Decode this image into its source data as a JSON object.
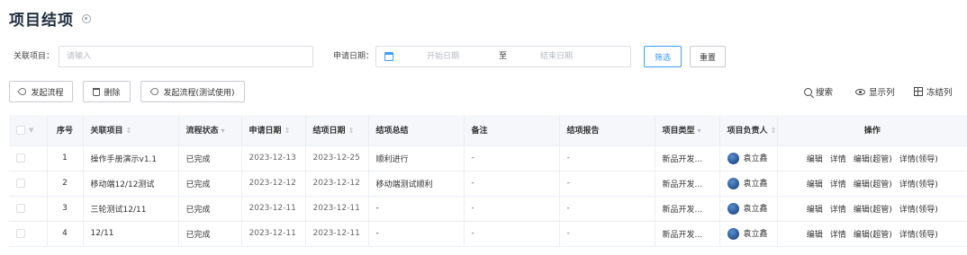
{
  "page": {
    "title": "项目结项",
    "settings_icon": "gear-icon"
  },
  "filters": {
    "project_label": "关联项目：",
    "project_placeholder": "请输入",
    "date_label": "申请日期：",
    "date_start_placeholder": "开始日期",
    "date_sep": "至",
    "date_end_placeholder": "结束日期",
    "filter_button": "筛选",
    "reset_button": "重置"
  },
  "toolbar": {
    "start_flow": "发起流程",
    "delete": "删除",
    "start_flow_test": "发起流程(测试使用)",
    "search": "搜索",
    "show_columns": "显示列",
    "freeze_columns": "冻结列"
  },
  "colors": {
    "accent": "#409eff",
    "header_bg": "#f5f7fa",
    "border": "#ebeef5"
  },
  "table": {
    "headers": {
      "index": "序号",
      "project": "关联项目",
      "flow_status": "流程状态",
      "apply_date": "申请日期",
      "close_date": "结项日期",
      "summary": "结项总结",
      "remark": "备注",
      "report": "结项报告",
      "type": "项目类型",
      "owner": "项目负责人",
      "actions": "操作"
    },
    "row_actions": {
      "edit": "编辑",
      "detail": "详情",
      "edit_super": "编辑(超管)",
      "detail_leader": "详情(领导)"
    },
    "rows": [
      {
        "index": "1",
        "project": "操作手册演示v1.1",
        "status": "已完成",
        "apply_date": "2023-12-13",
        "close_date": "2023-12-25",
        "summary": "顺利进行",
        "remark": "-",
        "report": "-",
        "type": "新品开发...",
        "owner": "袁立鑫"
      },
      {
        "index": "2",
        "project": "移动端12/12测试",
        "status": "已完成",
        "apply_date": "2023-12-12",
        "close_date": "2023-12-12",
        "summary": "移动端测试顺利",
        "remark": "-",
        "report": "-",
        "type": "新品开发...",
        "owner": "袁立鑫"
      },
      {
        "index": "3",
        "project": "三轮测试12/11",
        "status": "已完成",
        "apply_date": "2023-12-11",
        "close_date": "2023-12-11",
        "summary": "-",
        "remark": "-",
        "report": "-",
        "type": "新品开发...",
        "owner": "袁立鑫"
      },
      {
        "index": "4",
        "project": "12/11",
        "status": "已完成",
        "apply_date": "2023-12-11",
        "close_date": "2023-12-11",
        "summary": "-",
        "remark": "-",
        "report": "-",
        "type": "新品开发...",
        "owner": "袁立鑫"
      }
    ]
  }
}
